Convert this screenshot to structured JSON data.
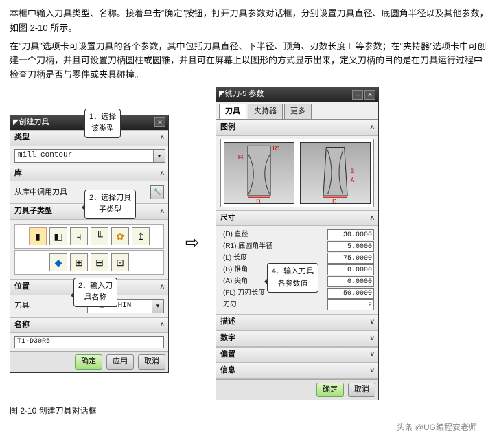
{
  "paragraphs": {
    "p1": "本框中输入刀具类型、名称。接着单击“确定”按钮，打开刀具参数对话框，分别设置刀具直径、底圆角半径以及其他参数，如图 2-10 所示。",
    "p2": "在“刀具”选项卡可设置刀具的各个参数，其中包括刀具直径、下半径、顶角、刃数长度 L 等参数；在“夹持器”选项卡中可创建一个刀柄，并且可设置刀柄圆柱或圆锥，并且可在屏幕上以图形的方式显示出来，定义刀柄的目的是在刀具运行过程中检查刀柄是否与零件或夹具碰撞。"
  },
  "callouts": {
    "c1": "1．选择\n该类型",
    "c2": "2．选择刀具\n子类型",
    "c3": "2．输入刀\n具名称",
    "c4": "4．输入刀具\n各参数值"
  },
  "left_dialog": {
    "title": "创建刀具",
    "sections": {
      "type": "类型",
      "library": "库",
      "lib_btn": "从库中调用刀具",
      "subtype": "刀具子类型",
      "location": "位置",
      "tool_label": "刀具",
      "tool_value": "IC_MACHIN",
      "name": "名称",
      "name_value": "T1-D30R5"
    },
    "type_value": "mill_contour",
    "buttons": {
      "ok": "确定",
      "apply": "应用",
      "cancel": "取消"
    }
  },
  "right_dialog": {
    "title": "铣刀-5 参数",
    "tabs": {
      "tool": "刀具",
      "holder": "夹持器",
      "more": "更多"
    },
    "sections": {
      "legend": "图例",
      "size": "尺寸",
      "desc": "描述",
      "num": "数字",
      "offset": "偏置",
      "info": "信息"
    },
    "dims": {
      "D": {
        "label": "(D) 直径",
        "value": "30.0000"
      },
      "R1": {
        "label": "(R1) 底圆角半径",
        "value": "5.0000"
      },
      "L": {
        "label": "(L) 长度",
        "value": "75.0000"
      },
      "B": {
        "label": "(B) 锥角",
        "value": "0.0000"
      },
      "A": {
        "label": "(A) 尖角",
        "value": "0.0000"
      },
      "FL": {
        "label": "(FL) 刀刃长度",
        "value": "50.0000"
      },
      "flutes": {
        "label": "刀刃",
        "value": "2"
      }
    },
    "buttons": {
      "ok": "确定",
      "cancel": "取消"
    }
  },
  "caption": "图 2-10  创建刀具对话框",
  "watermark": "头条 @UG编程安老师"
}
